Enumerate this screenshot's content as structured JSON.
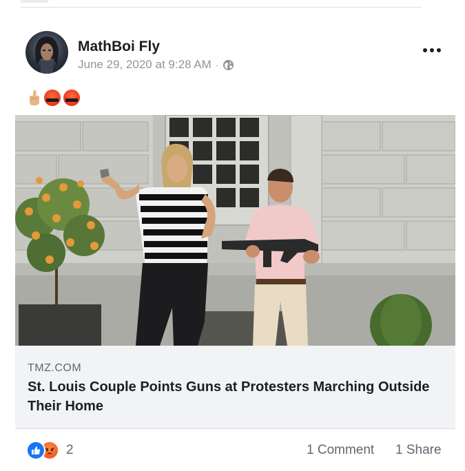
{
  "post": {
    "author": "MathBoi Fly",
    "timestamp": "June 29, 2020 at 9:28 AM",
    "separator": "·",
    "privacy_icon": "globe-icon",
    "more_icon": "more-options-icon",
    "status_emojis": [
      "middle-finger-emoji",
      "swearing-face-emoji",
      "swearing-face-emoji"
    ]
  },
  "link": {
    "domain": "TMZ.COM",
    "title": "St. Louis Couple Points Guns at Protesters Marching Outside Their Home",
    "image": "photo of a couple holding guns in front of a house"
  },
  "footer": {
    "reaction_count": "2",
    "reaction_icons": [
      "like-icon",
      "angry-icon"
    ],
    "comments": "1 Comment",
    "shares": "1 Share"
  },
  "colors": {
    "like_blue": "#1877f2",
    "angry_orange": "#e94b1b",
    "meta_gray": "#90949c",
    "card_bg": "#f2f3f5"
  }
}
